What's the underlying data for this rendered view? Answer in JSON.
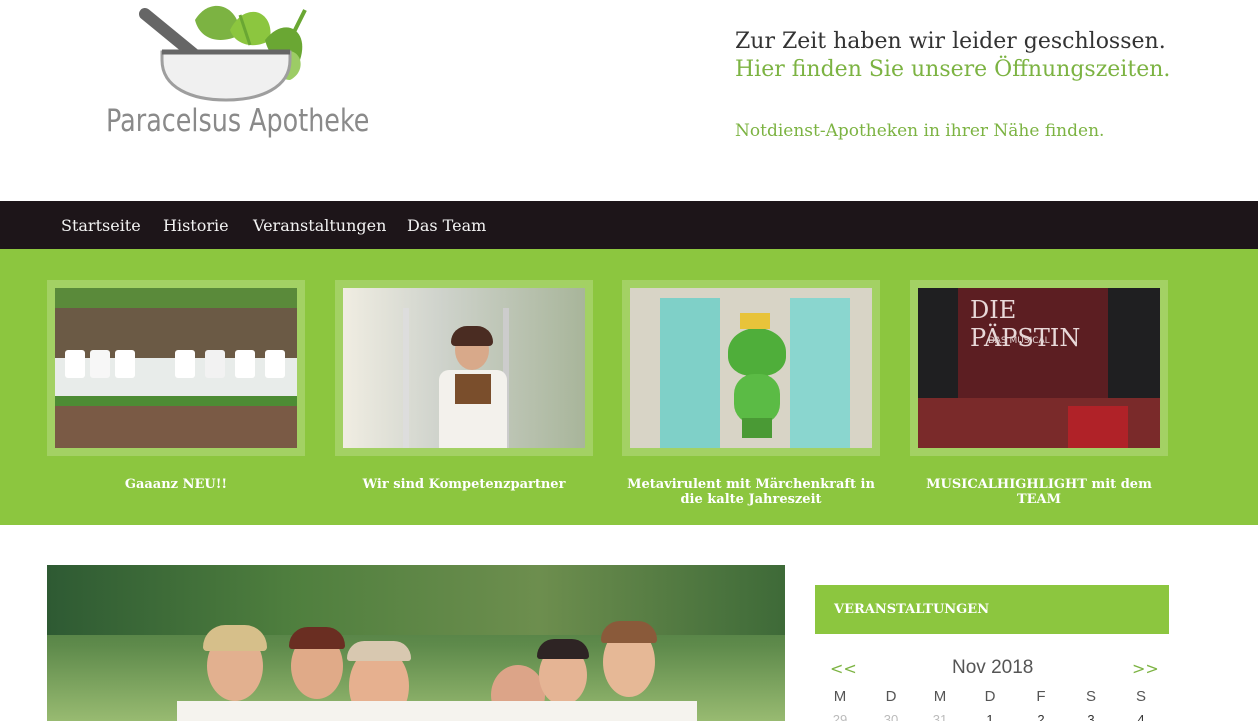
{
  "header": {
    "logo_text": "Paracelsus Apotheke",
    "closed_text": "Zur Zeit haben wir leider geschlossen.",
    "hours_link": "Hier finden Sie unsere Öffnungszeiten.",
    "notdienst_link": "Notdienst-Apotheken in ihrer Nähe finden."
  },
  "nav": {
    "items": [
      {
        "label": "Startseite"
      },
      {
        "label": "Historie"
      },
      {
        "label": "Veranstaltungen"
      },
      {
        "label": "Das Team"
      }
    ]
  },
  "featured": {
    "cards": [
      {
        "caption": "Gaaanz NEU!!",
        "image": "pharmacy-shelf-products"
      },
      {
        "caption": "Wir sind Kompetenzpartner",
        "image": "pharmacist-at-door"
      },
      {
        "caption": "Metavirulent mit Märchenkraft in die kalte Jahreszeit",
        "image": "frog-king-with-medicine-boxes"
      },
      {
        "caption": "MUSICALHIGHLIGHT mit dem TEAM",
        "image": "musical-tickets-die-paepstin"
      }
    ]
  },
  "main": {
    "image": "team-group-photo-garden"
  },
  "sidebar": {
    "widget_title": "VERANSTALTUNGEN",
    "calendar": {
      "prev": "<<",
      "next": ">>",
      "month": "Nov 2018",
      "weekdays": [
        "M",
        "D",
        "M",
        "D",
        "F",
        "S",
        "S"
      ],
      "first_row": [
        "29",
        "30",
        "31",
        "1",
        "2",
        "3",
        "4"
      ]
    }
  },
  "colors": {
    "accent_green": "#8cc63f",
    "link_green": "#7cb342",
    "nav_bg": "#1d1519"
  }
}
